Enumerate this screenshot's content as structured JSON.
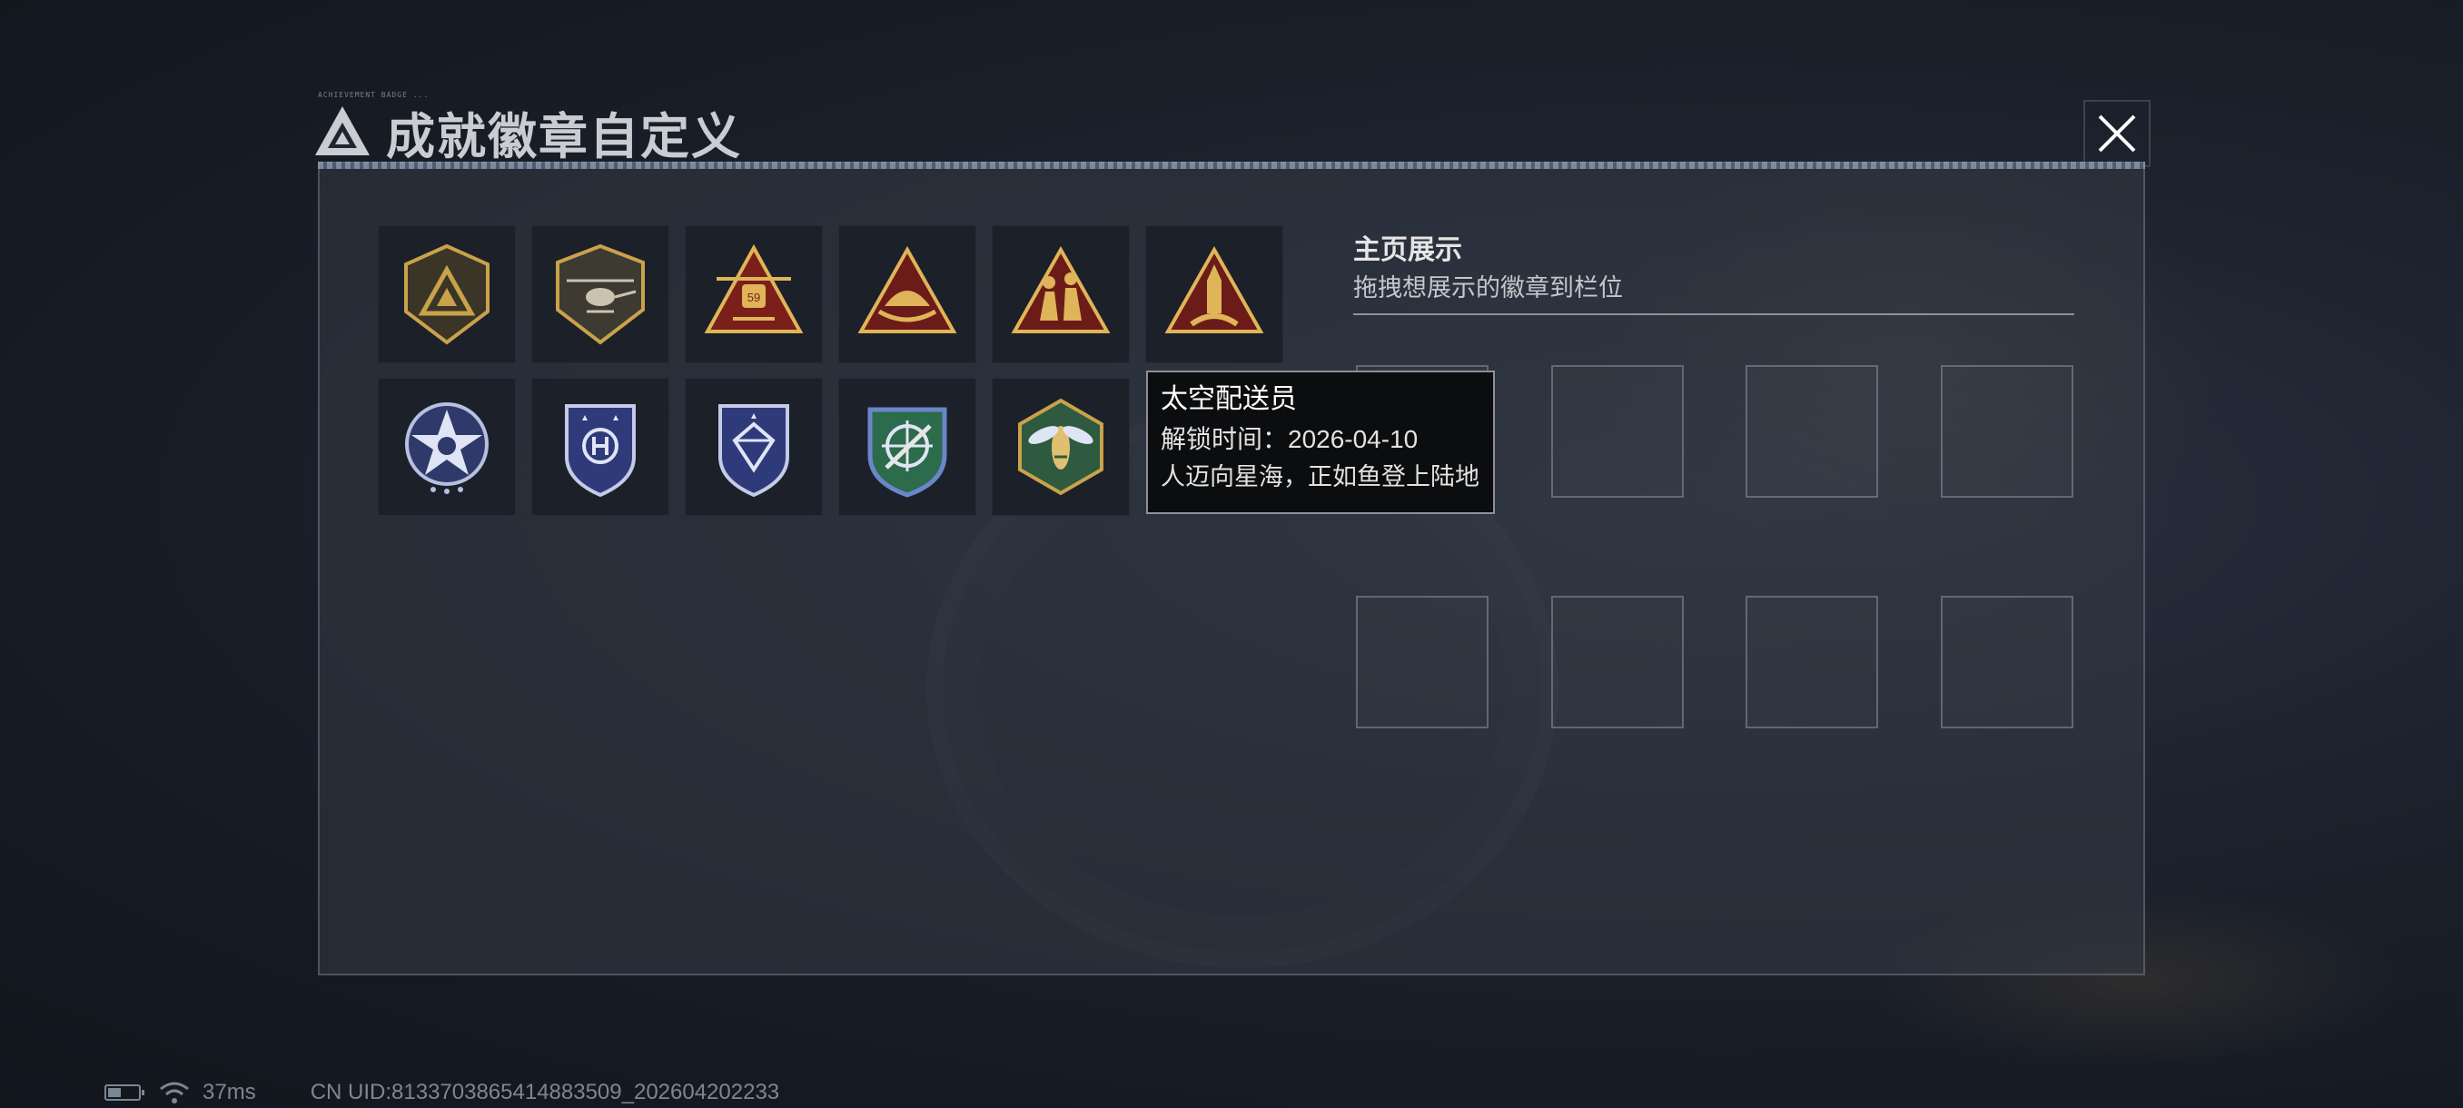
{
  "header": {
    "title": "成就徽章自定义",
    "tiny_text": "ACHIEVEMENT BADGE ..."
  },
  "badges": [
    {
      "name": "delta-triangle-shield-badge",
      "tier": "gold"
    },
    {
      "name": "helicopter-shield-badge",
      "tier": "gold"
    },
    {
      "name": "helicopter-59-badge",
      "tier": "gold"
    },
    {
      "name": "helmet-triangle-badge",
      "tier": "gold"
    },
    {
      "name": "soldiers-triangle-badge",
      "tier": "gold"
    },
    {
      "name": "rocket-triangle-badge",
      "tier": "gold"
    },
    {
      "name": "star-emblem-badge",
      "tier": "silver"
    },
    {
      "name": "wing-shield-badge",
      "tier": "silver"
    },
    {
      "name": "diamond-shield-badge",
      "tier": "silver"
    },
    {
      "name": "crosshair-shield-badge",
      "tier": "green"
    },
    {
      "name": "wasp-hexagon-badge",
      "tier": "green"
    }
  ],
  "showcase": {
    "title": "主页展示",
    "subtitle": "拖拽想展示的徽章到栏位",
    "slot_count": 8
  },
  "tooltip": {
    "name": "太空配送员",
    "unlock_time": "解锁时间：2026-04-10",
    "description": "人迈向星海，正如鱼登上陆地"
  },
  "status": {
    "ping": "37ms",
    "uid": "CN UID:8133703865414883509_202604202233"
  },
  "colors": {
    "gold": "#c9a24a",
    "silver": "#aab4d8",
    "green": "#2e7a4f",
    "accent_bg": "#1c2029"
  }
}
